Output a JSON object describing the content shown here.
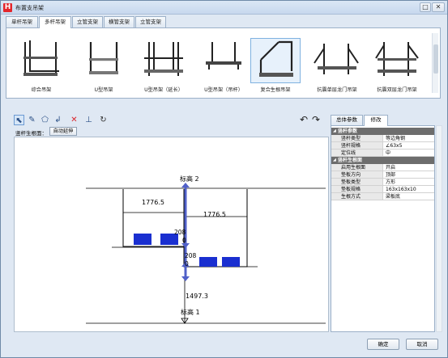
{
  "window": {
    "title": "布置支吊架"
  },
  "tabs": [
    {
      "label": "单杆吊架"
    },
    {
      "label": "多杆吊架"
    },
    {
      "label": "立管支架"
    },
    {
      "label": "横管支架"
    },
    {
      "label": "立管支架"
    }
  ],
  "gallery": {
    "items": [
      {
        "label": "综合吊架"
      },
      {
        "label": "U型吊架"
      },
      {
        "label": "U型吊架（延长）"
      },
      {
        "label": "U型吊架（吊杆）"
      },
      {
        "label": "复合生根吊架"
      },
      {
        "label": "抗震单层龙门吊架"
      },
      {
        "label": "抗震双层龙门吊架"
      }
    ]
  },
  "toolbar": {
    "root_label": "竖杆生根面：",
    "extend_button": "自动延伸"
  },
  "drawing": {
    "level_top": "标高 2",
    "level_bottom": "标高 1",
    "dim_left": "1776.5",
    "dim_right": "1776.5",
    "tier1_value_a": "208",
    "tier1_value_b": "0",
    "tier2_value_a": "208",
    "tier2_value_b": "0",
    "height_value": "1497.3"
  },
  "properties": {
    "tabs": [
      {
        "label": "总体参数"
      },
      {
        "label": "修改"
      }
    ],
    "groups": [
      {
        "title": "竖杆参数",
        "rows": [
          {
            "key": "竖杆类型",
            "value": "等边角钢"
          },
          {
            "key": "竖杆规格",
            "value": "∠63x5"
          },
          {
            "key": "定位线",
            "value": "中"
          }
        ]
      },
      {
        "title": "竖杆生根面",
        "rows": [
          {
            "key": "启用生根面",
            "value": "开启"
          },
          {
            "key": "垫板方向",
            "value": "顶部"
          },
          {
            "key": "垫板类型",
            "value": "方形"
          },
          {
            "key": "垫板规格",
            "value": "163x163x10"
          },
          {
            "key": "生根方式",
            "value": "梁板底"
          }
        ]
      }
    ]
  },
  "footer": {
    "ok": "确定",
    "cancel": "取消"
  },
  "colors": {
    "accent": "#1a2fd0",
    "level_line": "#5060c8"
  }
}
